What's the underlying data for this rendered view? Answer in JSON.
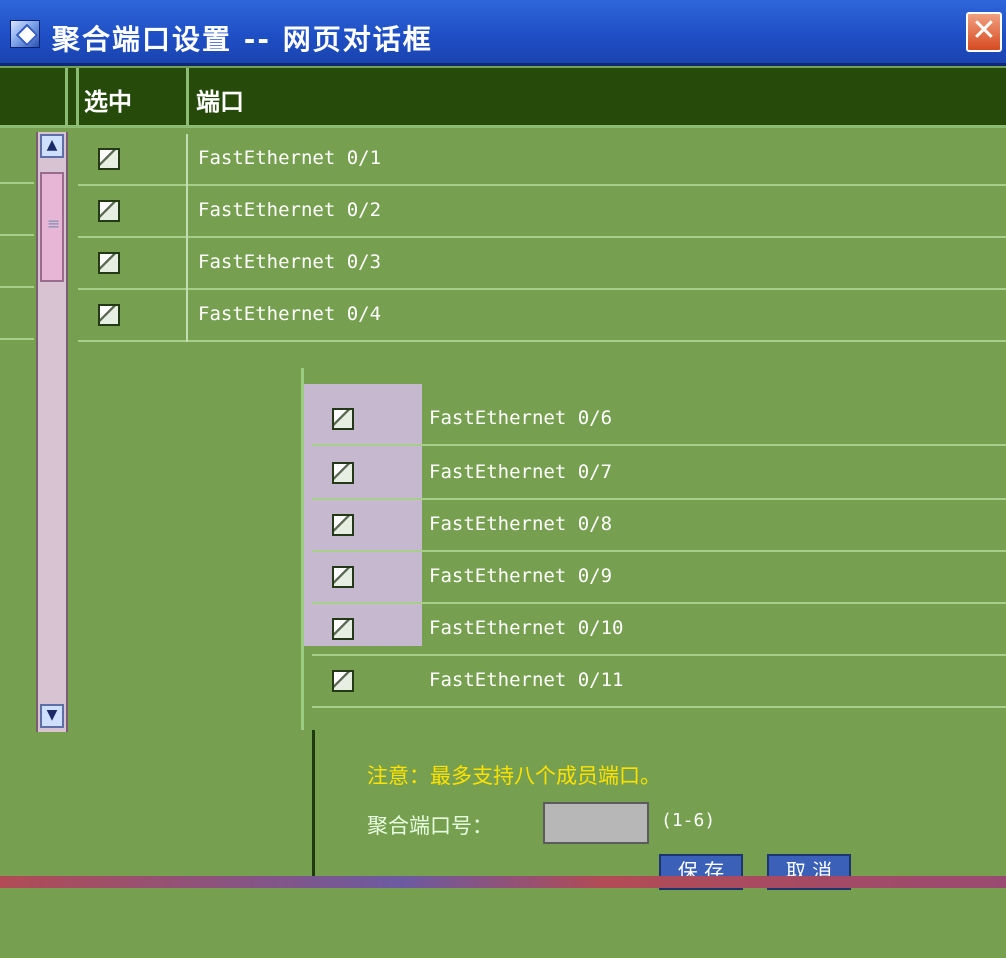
{
  "titlebar": {
    "title": "聚合端口设置 -- 网页对话框",
    "close_icon": "close-icon"
  },
  "table": {
    "headers": {
      "selected": "选中",
      "port": "端口"
    },
    "rows": [
      {
        "label": "FastEthernet 0/1"
      },
      {
        "label": "FastEthernet 0/2"
      },
      {
        "label": "FastEthernet 0/3"
      },
      {
        "label": "FastEthernet 0/4"
      },
      {
        "label": "FastEthernet 0/6"
      },
      {
        "label": "FastEthernet 0/7"
      },
      {
        "label": "FastEthernet 0/8"
      },
      {
        "label": "FastEthernet 0/9"
      },
      {
        "label": "FastEthernet 0/10"
      },
      {
        "label": "FastEthernet 0/11"
      }
    ]
  },
  "form": {
    "note": "注意：最多支持八个成员端口。",
    "agg_port_label": "聚合端口号：",
    "agg_port_value": "",
    "range_hint": "(1-6)"
  },
  "buttons": {
    "save": "保 存",
    "cancel": "取 消"
  },
  "colors": {
    "title_blue": "#1f4fc6",
    "bg_green": "#76a050",
    "header_dark_green": "#264a0a",
    "note_yellow": "#ffe100"
  }
}
